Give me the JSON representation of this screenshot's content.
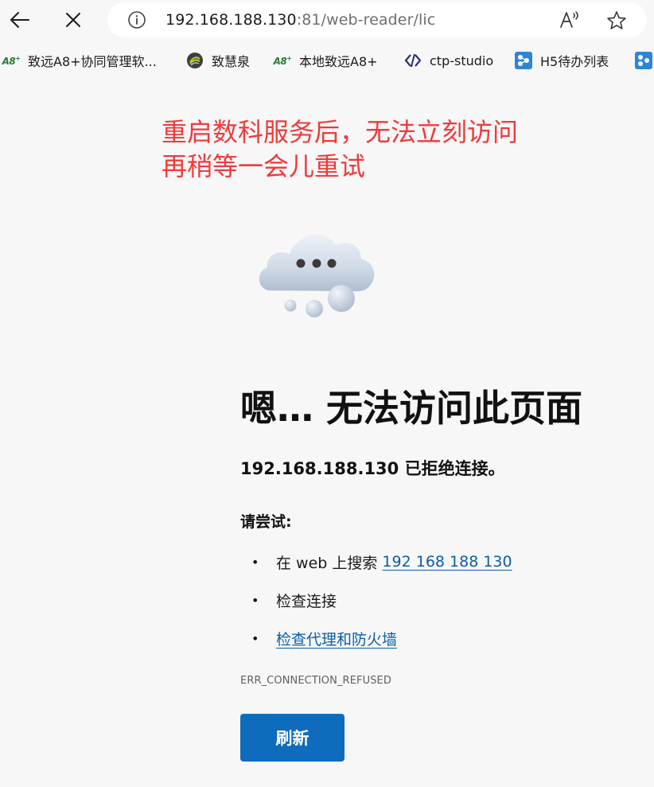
{
  "toolbar": {
    "back_icon": "arrow-left-icon",
    "close_icon": "close-x-icon",
    "address": {
      "host": "192.168.188.130",
      "rest": ":81/web-reader/lic"
    },
    "read_aloud_icon": "read-aloud-icon",
    "favorite_icon": "star-icon"
  },
  "bookmarks": [
    {
      "label": "致远A8+协同管理软...",
      "icon": "a8-logo-icon",
      "icon_text": "A8"
    },
    {
      "label": "致慧泉",
      "icon": "swirl-logo-icon"
    },
    {
      "label": "本地致远A8+",
      "icon": "a8-logo-icon",
      "icon_text": "A8"
    },
    {
      "label": "ctp-studio",
      "icon": "code-brackets-icon"
    },
    {
      "label": "H5待办列表",
      "icon": "blue-app-icon"
    },
    {
      "label": "",
      "icon": "blue-app-icon"
    }
  ],
  "note": {
    "line1": "重启数科服务后，无法立刻访问",
    "line2": "再稍等一会儿重试",
    "color": "#ef3a3a"
  },
  "error": {
    "title": "嗯… 无法访问此页面",
    "subtitle": "192.168.188.130 已拒绝连接。",
    "try_label": "请尝试:",
    "suggestions": [
      {
        "prefix": "在 web 上搜索 ",
        "link": "192 168 188 130"
      },
      {
        "prefix": "检查连接",
        "link": ""
      },
      {
        "prefix": "",
        "link": "检查代理和防火墙"
      }
    ],
    "code": "ERR_CONNECTION_REFUSED",
    "refresh_label": "刷新"
  },
  "colors": {
    "accent": "#0f6cbd",
    "link": "#0a5ea8",
    "background": "#f7f7f7"
  }
}
